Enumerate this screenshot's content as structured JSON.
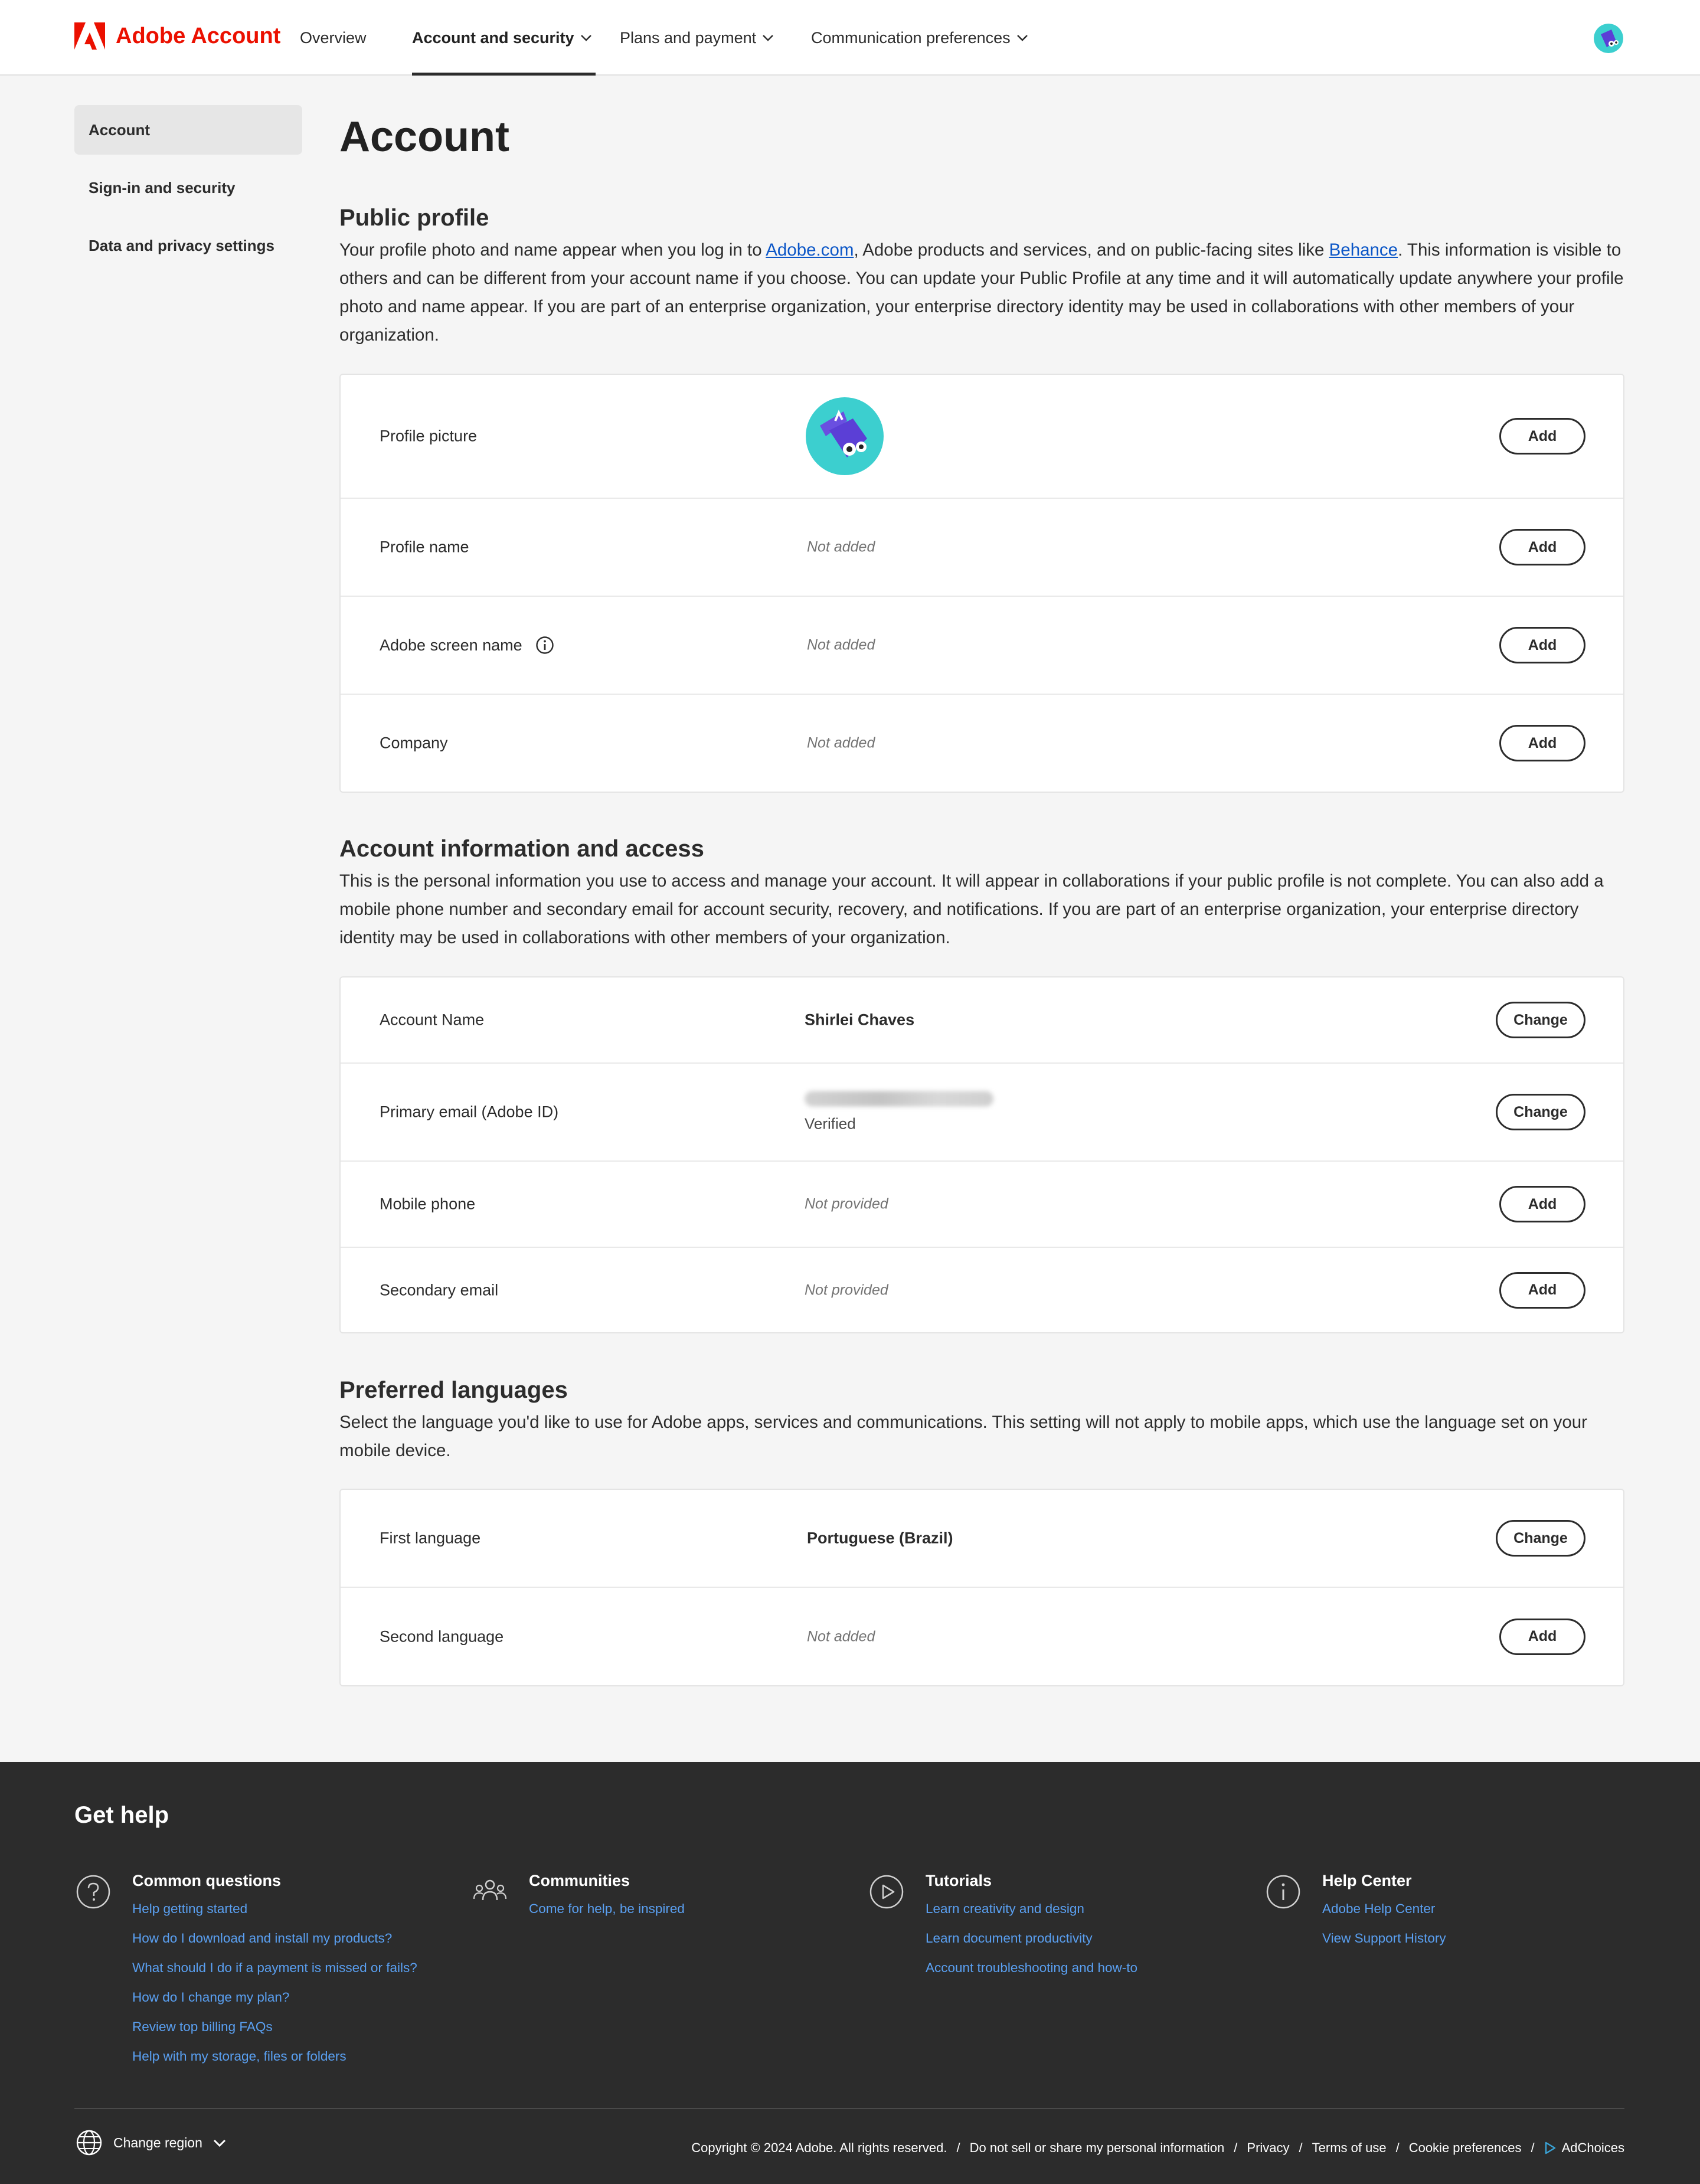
{
  "brand": {
    "name": "Adobe Account",
    "color": "#eb1000"
  },
  "nav": {
    "items": [
      {
        "label": "Overview",
        "dropdown": false,
        "active": false
      },
      {
        "label": "Account and security",
        "dropdown": true,
        "active": true
      },
      {
        "label": "Plans and payment",
        "dropdown": true,
        "active": false
      },
      {
        "label": "Communication preferences",
        "dropdown": true,
        "active": false
      }
    ]
  },
  "sidebar": {
    "items": [
      {
        "label": "Account",
        "active": true
      },
      {
        "label": "Sign-in and security",
        "active": false
      },
      {
        "label": "Data and privacy settings",
        "active": false
      }
    ]
  },
  "page": {
    "title": "Account"
  },
  "public_profile": {
    "title": "Public profile",
    "desc_1": "Your profile photo and name appear when you log in to ",
    "link_1": "Adobe.com",
    "desc_2": ", Adobe products and services, and on public-facing sites like ",
    "link_2": "Behance",
    "desc_3": ". This information is visible to others and can be different from your account name if you choose. You can update your Public Profile at any time and it will automatically update anywhere your profile photo and name appear. If you are part of an enterprise organization, your enterprise directory identity may be used in collaborations with other members of your organization.",
    "rows": [
      {
        "label": "Profile picture",
        "value": "",
        "button": "Add"
      },
      {
        "label": "Profile name",
        "value": "Not added",
        "button": "Add"
      },
      {
        "label": "Adobe screen name",
        "value": "Not added",
        "button": "Add",
        "info_icon": "info-icon"
      },
      {
        "label": "Company",
        "value": "Not added",
        "button": "Add"
      }
    ]
  },
  "account_info": {
    "title": "Account information and access",
    "desc": "This is the personal information you use to access and manage your account. It will appear in collaborations if your public profile is not complete. You can also add a mobile phone number and secondary email for account security, recovery, and notifications. If you are part of an enterprise organization, your enterprise directory identity may be used in collaborations with other members of your organization.",
    "rows": [
      {
        "label": "Account Name",
        "value": "Shirlei Chaves",
        "button": "Change"
      },
      {
        "label": "Primary email (Adobe ID)",
        "value": "Verified",
        "button": "Change"
      },
      {
        "label": "Mobile phone",
        "value": "Not provided",
        "button": "Add"
      },
      {
        "label": "Secondary email",
        "value": "Not provided",
        "button": "Add"
      }
    ]
  },
  "languages": {
    "title": "Preferred languages",
    "desc": "Select the language you'd like to use for Adobe apps, services and communications. This setting will not apply to mobile apps, which use the language set on your mobile device.",
    "rows": [
      {
        "label": "First language",
        "value": "Portuguese (Brazil)",
        "button": "Change"
      },
      {
        "label": "Second language",
        "value": "Not added",
        "button": "Add"
      }
    ]
  },
  "footer": {
    "title": "Get help",
    "columns": [
      {
        "icon": "question-circle-icon",
        "heading": "Common questions",
        "links": [
          "Help getting started",
          "How do I download and install my products?",
          "What should I do if a payment is missed or fails?",
          "How do I change my plan?",
          "Review top billing FAQs",
          "Help with my storage, files or folders"
        ]
      },
      {
        "icon": "people-icon",
        "heading": "Communities",
        "links": [
          "Come for help, be inspired"
        ]
      },
      {
        "icon": "play-circle-icon",
        "heading": "Tutorials",
        "links": [
          "Learn creativity and design",
          "Learn document productivity",
          "Account troubleshooting and how-to"
        ]
      },
      {
        "icon": "info-circle-icon",
        "heading": "Help Center",
        "links": [
          "Adobe Help Center",
          "View Support History"
        ]
      }
    ],
    "region_label": "Change region",
    "copyright": "Copyright © 2024 Adobe. All rights reserved.",
    "legal_links": [
      "Do not sell or share my personal information",
      "Privacy",
      "Terms of use",
      "Cookie preferences",
      "AdChoices"
    ],
    "separator": "/",
    "link_color": "#5aa0f2"
  }
}
